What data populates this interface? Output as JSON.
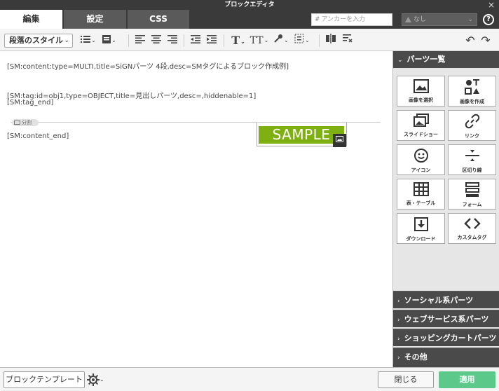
{
  "window": {
    "title": "ブロックエディタ",
    "close": "×"
  },
  "tabs": [
    {
      "label": "編集",
      "active": true
    },
    {
      "label": "設定",
      "active": false
    },
    {
      "label": "CSS",
      "active": false
    }
  ],
  "anchor": {
    "hash": "#",
    "placeholder": "アンカーを入力"
  },
  "nashi_select": {
    "value": "なし"
  },
  "help": "?",
  "toolbar": {
    "style_select": "段落のスタイル"
  },
  "editor": {
    "lines": [
      "[SM:content:type=MULTI,title=SiGNパーツ 4段,desc=SMタグによるブロック作成例]",
      "[SM:tag:id=obj1,type=OBJECT,title=見出しパーツ,desc=,hiddenable=1]",
      "[SM:tag_end]",
      "[SM:content_end]"
    ],
    "sample_text": "SAMPLE",
    "divider_label": "分割"
  },
  "panel": {
    "title": "パーツ一覧",
    "parts": [
      {
        "label": "画像を選択",
        "icon": "image-icon"
      },
      {
        "label": "画像を作成",
        "icon": "shapes-icon"
      },
      {
        "label": "スライドショー",
        "icon": "slideshow-icon"
      },
      {
        "label": "リンク",
        "icon": "link-icon"
      },
      {
        "label": "アイコン",
        "icon": "smiley-icon"
      },
      {
        "label": "区切り線",
        "icon": "divider-icon"
      },
      {
        "label": "表・テーブル",
        "icon": "table-icon"
      },
      {
        "label": "フォーム",
        "icon": "form-icon"
      },
      {
        "label": "ダウンロード",
        "icon": "download-icon"
      },
      {
        "label": "カスタムタグ",
        "icon": "code-icon"
      }
    ],
    "sections": [
      "ソーシャル系パーツ",
      "ウェブサービス系パーツ",
      "ショッピングカートパーツ",
      "その他"
    ]
  },
  "bottom": {
    "template_button": "ブロックテンプレート",
    "close_button": "閉じる",
    "apply_button": "適用"
  },
  "colors": {
    "accent": "#5cc98a",
    "dark": "#3a3a3a",
    "sample_bg": "#7fb011"
  }
}
